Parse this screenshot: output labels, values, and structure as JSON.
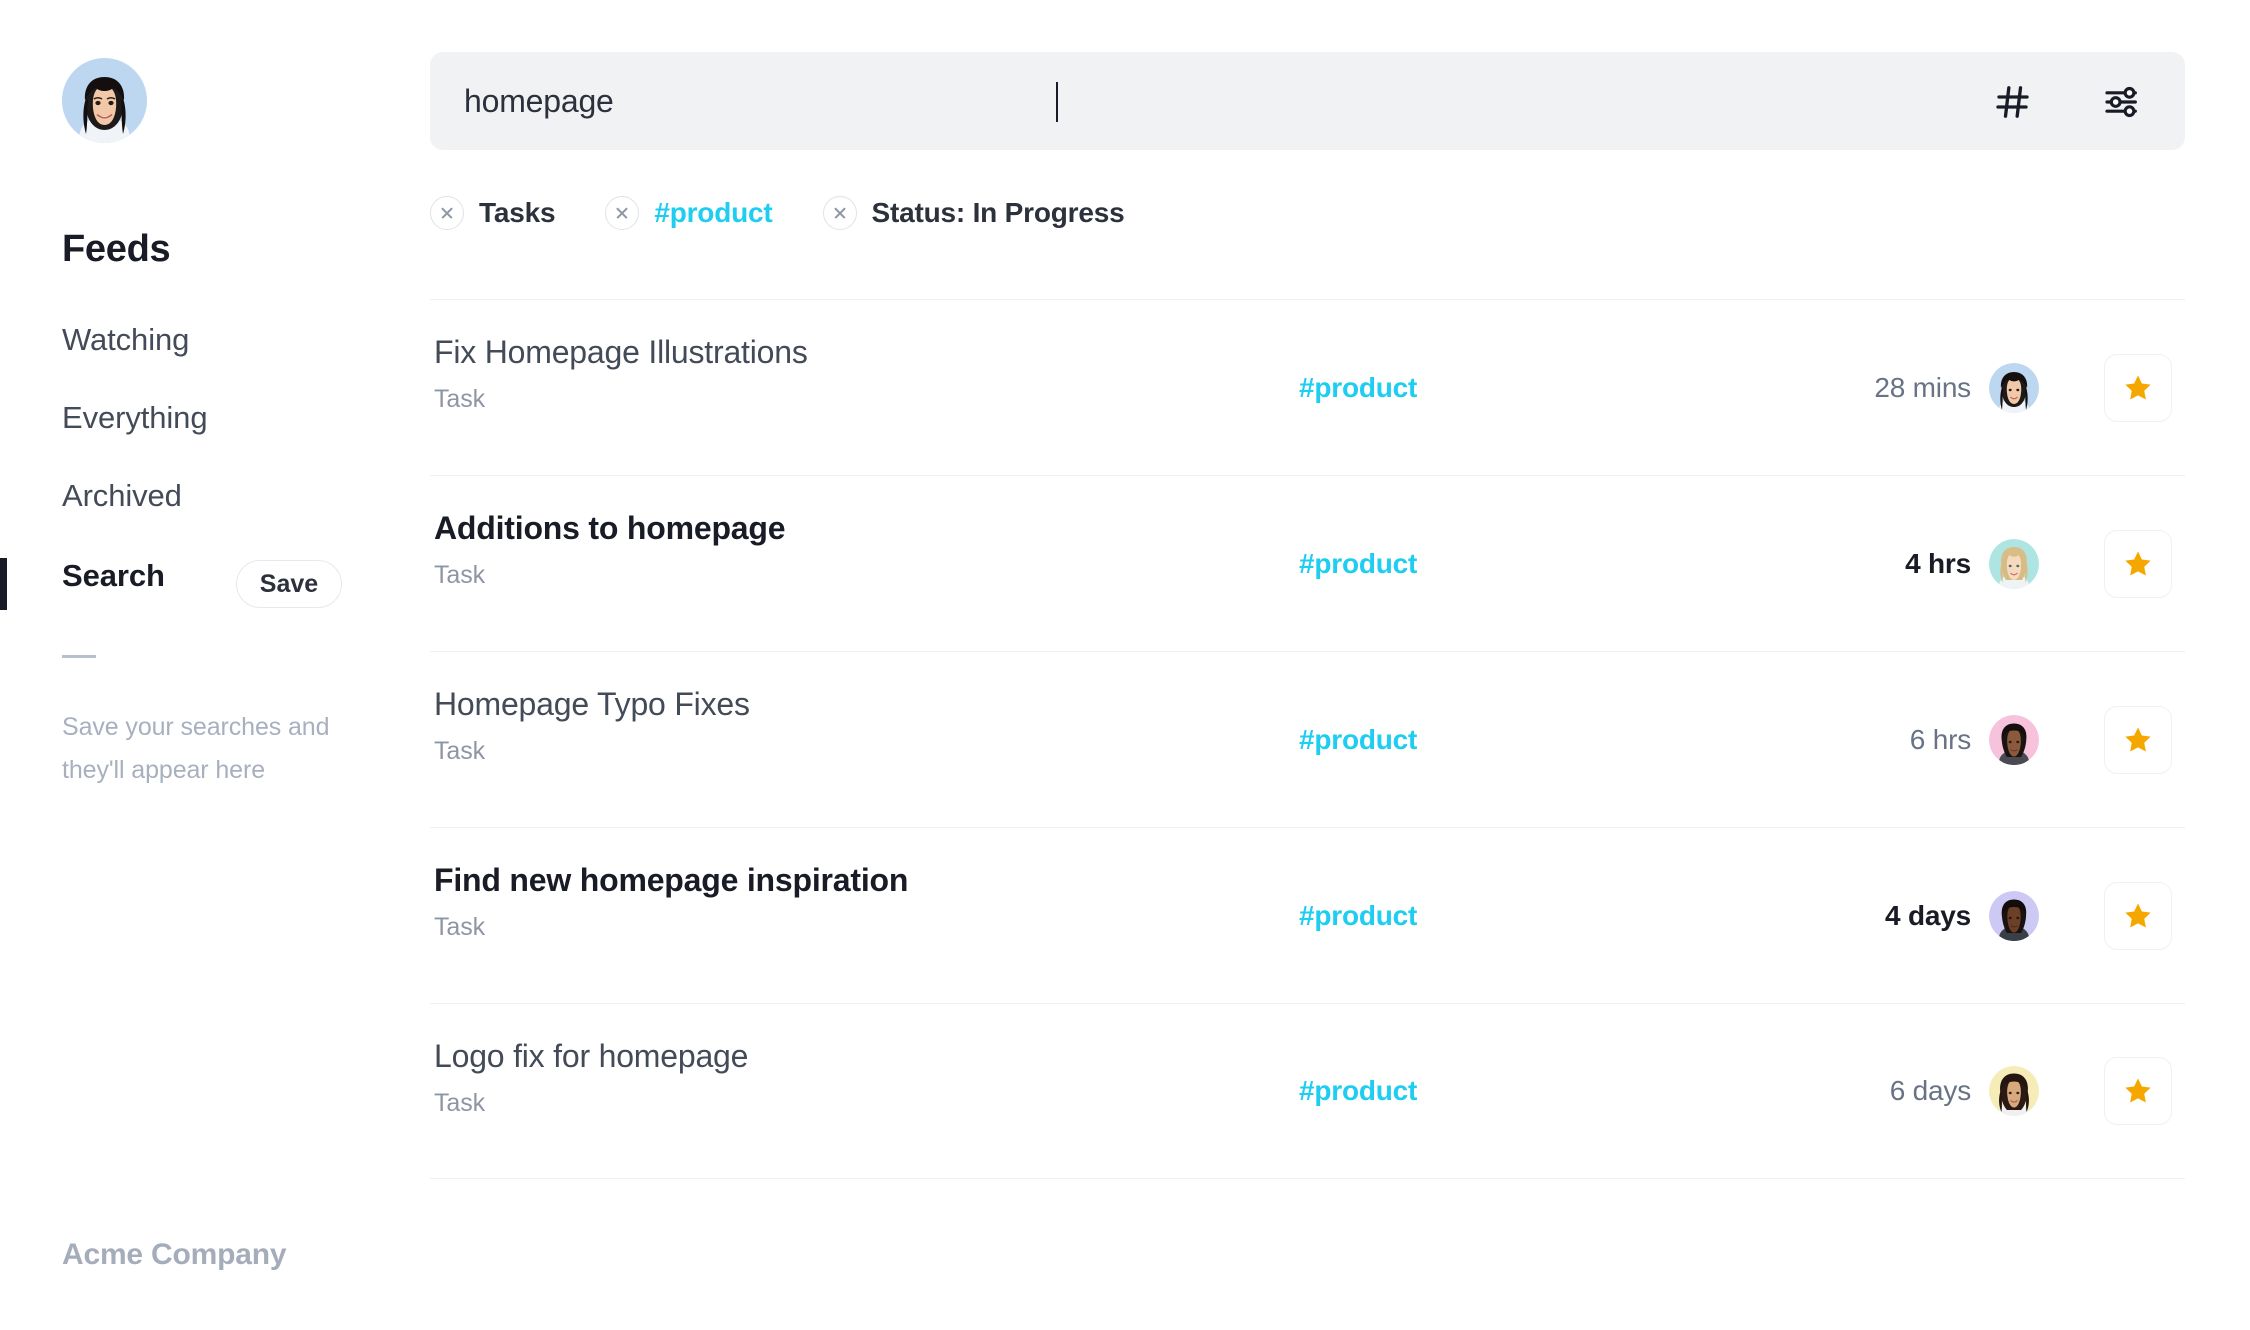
{
  "colors": {
    "accent_cyan": "#1ecdf0",
    "star_gold": "#F5A700",
    "text_dark": "#191c26",
    "text_body": "#444b58",
    "text_muted": "#8d96a5",
    "search_bg": "#f1f2f4",
    "divider": "#eef0f2"
  },
  "sidebar": {
    "avatar_name": "user-avatar",
    "title": "Feeds",
    "items": [
      {
        "label": "Watching",
        "active": false
      },
      {
        "label": "Everything",
        "active": false
      },
      {
        "label": "Archived",
        "active": false
      },
      {
        "label": "Search",
        "active": true
      }
    ],
    "save_label": "Save",
    "empty_hint": "Save your searches and they'll appear here",
    "company": "Acme Company"
  },
  "search": {
    "value": "homepage",
    "placeholder": "Search",
    "icons": [
      {
        "name": "hash-icon"
      },
      {
        "name": "sliders-icon"
      }
    ]
  },
  "chips": [
    {
      "label": "Tasks",
      "accent": false
    },
    {
      "label": "#product",
      "accent": true
    },
    {
      "label": "Status: In Progress",
      "accent": false
    }
  ],
  "results": [
    {
      "title": "Fix Homepage Illustrations",
      "type": "Task",
      "tag": "#product",
      "time": "28 mins",
      "unread": false,
      "avatar_bg": "#bdd7f0",
      "avatar_name": "assignee-avatar",
      "starred": true
    },
    {
      "title": "Additions to homepage",
      "type": "Task",
      "tag": "#product",
      "time": "4 hrs",
      "unread": true,
      "avatar_bg": "#aee5e3",
      "avatar_name": "assignee-avatar",
      "starred": true
    },
    {
      "title": "Homepage Typo Fixes",
      "type": "Task",
      "tag": "#product",
      "time": "6 hrs",
      "unread": false,
      "avatar_bg": "#f7c2dc",
      "avatar_name": "assignee-avatar",
      "starred": true
    },
    {
      "title": "Find new homepage inspiration",
      "type": "Task",
      "tag": "#product",
      "time": "4 days",
      "unread": true,
      "avatar_bg": "#cdc9f5",
      "avatar_name": "assignee-avatar",
      "starred": true
    },
    {
      "title": "Logo fix for homepage",
      "type": "Task",
      "tag": "#product",
      "time": "6 days",
      "unread": false,
      "avatar_bg": "#f6ecb8",
      "avatar_name": "assignee-avatar",
      "starred": true
    }
  ]
}
